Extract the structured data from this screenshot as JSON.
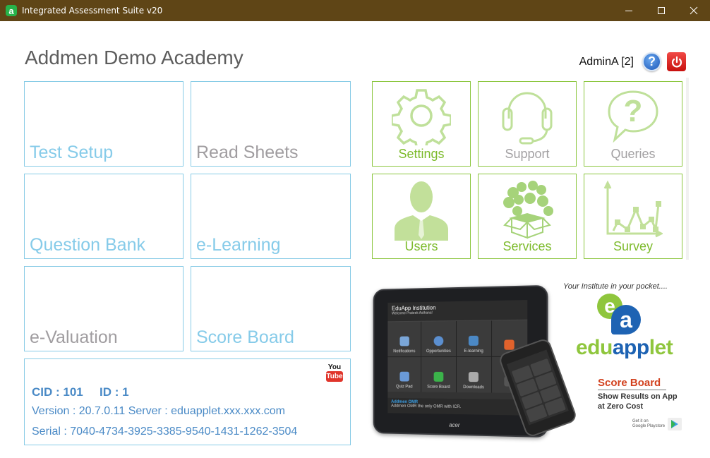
{
  "window": {
    "title": "Integrated Assessment Suite v20",
    "app_icon_letter": "a",
    "controls": {
      "minimize": "minimize-icon",
      "maximize": "maximize-icon",
      "close": "close-icon"
    }
  },
  "header": {
    "academy_name": "Addmen Demo Academy",
    "user_label": "AdminA [2]",
    "help_symbol": "?"
  },
  "left_tiles": [
    {
      "label": "Test Setup",
      "color": "#86cbe9"
    },
    {
      "label": "Read Sheets",
      "color": "#a09da0"
    },
    {
      "label": "Question Bank",
      "color": "#86cbe9"
    },
    {
      "label": "e-Learning",
      "color": "#86cbe9"
    },
    {
      "label": "e-Valuation",
      "color": "#a09da0"
    },
    {
      "label": "Score Board",
      "color": "#86cbe9"
    }
  ],
  "right_tiles": [
    {
      "label": "Settings",
      "icon": "gear-icon",
      "label_color": "#7dbb2c"
    },
    {
      "label": "Support",
      "icon": "headset-icon",
      "label_color": "#a3a1a3"
    },
    {
      "label": "Queries",
      "icon": "question-bubble-icon",
      "label_color": "#a3a1a3"
    },
    {
      "label": "Users",
      "icon": "user-icon",
      "label_color": "#7dbb2c"
    },
    {
      "label": "Services",
      "icon": "services-box-icon",
      "label_color": "#7dbb2c"
    },
    {
      "label": "Survey",
      "icon": "line-chart-icon",
      "label_color": "#7dbb2c"
    }
  ],
  "info": {
    "cid_label": "CID : 101",
    "id_label": "ID : 1",
    "version_line": "Version : 20.7.0.11  Server : eduapplet.xxx.xxx.com",
    "serial_line": "Serial : 7040-4734-3925-3385-9540-1431-1262-3504",
    "youtube_top": "You",
    "youtube_bottom": "Tube"
  },
  "promo": {
    "tagline": "Your Institute in your pocket....",
    "logo_e": "e",
    "logo_a": "a",
    "brand_edu": "edu",
    "brand_app": "app",
    "brand_let": "let",
    "feature_title": "Score Board",
    "feature_line1": "Show Results on App",
    "feature_line2": "at Zero Cost",
    "store_line1": "Get it on",
    "store_line2": "Google Playstore",
    "tablet": {
      "app_name": "EduApp Institution",
      "welcome": "Welcome Prateek Asthana!",
      "tiles": [
        "Notifications",
        "Opportunities",
        "E-learning",
        "",
        "Quiz Pad",
        "Score Board",
        "Downloads",
        ""
      ],
      "footer_title": "Addmen OMR",
      "footer_text": "Addmen OMR the only OMR with ICR.",
      "brand": "acer"
    }
  }
}
